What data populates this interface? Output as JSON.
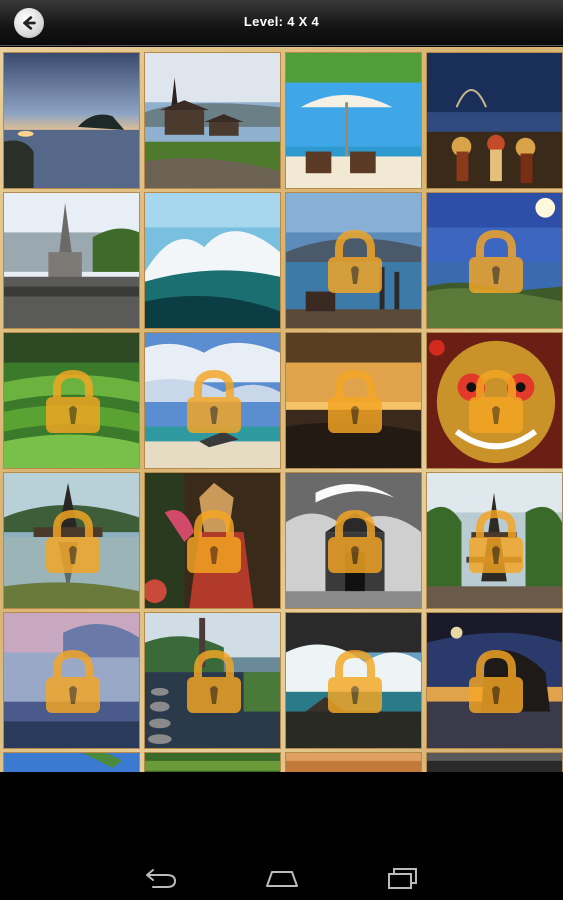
{
  "header": {
    "title": "Level: 4 X 4"
  },
  "tiles": [
    {
      "scene": "sunset-sea-rock",
      "locked": false
    },
    {
      "scene": "temple-lake",
      "locked": false
    },
    {
      "scene": "beach-umbrella",
      "locked": false
    },
    {
      "scene": "dancers-night",
      "locked": false
    },
    {
      "scene": "temple-tower",
      "locked": false
    },
    {
      "scene": "wave-crash",
      "locked": false
    },
    {
      "scene": "pier-mountain",
      "locked": true
    },
    {
      "scene": "coast-sky",
      "locked": true
    },
    {
      "scene": "rice-terraces",
      "locked": true
    },
    {
      "scene": "boat-beach-clouds",
      "locked": true
    },
    {
      "scene": "sunset-ocean",
      "locked": true
    },
    {
      "scene": "barong-mask",
      "locked": true
    },
    {
      "scene": "lake-pagoda",
      "locked": true
    },
    {
      "scene": "dancer-costume",
      "locked": true
    },
    {
      "scene": "bw-temple-gate",
      "locked": true
    },
    {
      "scene": "pagoda-garden",
      "locked": true
    },
    {
      "scene": "pink-sky-sea",
      "locked": true
    },
    {
      "scene": "stepping-stones",
      "locked": true
    },
    {
      "scene": "waves-rocks",
      "locked": true
    },
    {
      "scene": "rock-sunset",
      "locked": true
    },
    {
      "scene": "partial-blue",
      "locked": false
    },
    {
      "scene": "partial-green",
      "locked": false
    },
    {
      "scene": "partial-orange",
      "locked": false
    },
    {
      "scene": "partial-dark",
      "locked": false
    }
  ],
  "icons": {
    "back": "back-arrow-icon",
    "lock": "padlock-icon",
    "nav_back": "nav-back-icon",
    "nav_home": "nav-home-icon",
    "nav_recents": "nav-recents-icon"
  },
  "colors": {
    "lock": "#f5a623",
    "board": "#ddb978"
  }
}
